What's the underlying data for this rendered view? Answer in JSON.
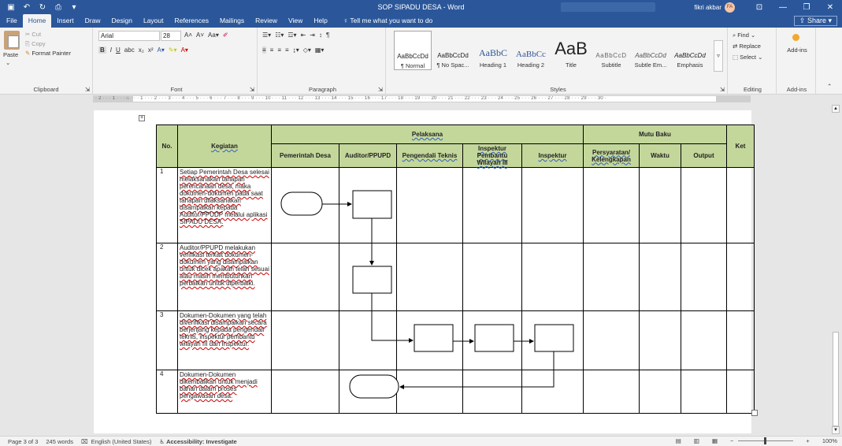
{
  "window": {
    "title": "SOP SIPADU DESA  -  Word",
    "user": "fikri akbar",
    "avatar": "FA"
  },
  "qat": {
    "save_icon": "save-icon",
    "undo_icon": "undo-icon",
    "redo_icon": "redo-icon",
    "preview_icon": "print-preview-icon"
  },
  "tabs": [
    "File",
    "Home",
    "Insert",
    "Draw",
    "Design",
    "Layout",
    "References",
    "Mailings",
    "Review",
    "View",
    "Help"
  ],
  "tell_me": "Tell me what you want to do",
  "share": "Share",
  "ribbon": {
    "clipboard": {
      "label": "Clipboard",
      "paste": "Paste",
      "cut": "Cut",
      "copy": "Copy",
      "format_painter": "Format Painter"
    },
    "font": {
      "label": "Font",
      "name": "Arial",
      "size": "28"
    },
    "paragraph": {
      "label": "Paragraph"
    },
    "styles": {
      "label": "Styles",
      "items": [
        {
          "sample": "AaBbCcDd",
          "name": "¶ Normal"
        },
        {
          "sample": "AaBbCcDd",
          "name": "¶ No Spac..."
        },
        {
          "sample": "AaBbC",
          "name": "Heading 1"
        },
        {
          "sample": "AaBbCc",
          "name": "Heading 2"
        },
        {
          "sample": "AaB",
          "name": "Title"
        },
        {
          "sample": "AaBbCcD",
          "name": "Subtitle"
        },
        {
          "sample": "AaBbCcDd",
          "name": "Subtle Em..."
        },
        {
          "sample": "AaBbCcDd",
          "name": "Emphasis"
        }
      ]
    },
    "editing": {
      "label": "Editing",
      "find": "Find",
      "replace": "Replace",
      "select": "Select"
    },
    "addins": {
      "label": "Add-ins",
      "button": "Add-ins"
    }
  },
  "ruler": "· 2 · · · 1 · · · ⌂ · · · 1 · · · 2 · · · 3 · · · 4 · · · 5 · · · 6 · · · 7 · · · 8 · · · 9 · · · 10 · · · 11 · · · 12 · · · 13 · · · 14 · · · 15 · · · 16 · · · 17 · · · 18 · · · 19 · · · 20 · · · 21 · · · 22 · · · 23 · · · 24 · · · 25 · · · 26 · · · 27 · · · 28 · · · 29 · · · 30 ·",
  "table": {
    "headers": {
      "no": "No.",
      "kegiatan": "Kegiatan",
      "pelaksana": "Pelaksana",
      "mutu_baku": "Mutu Baku",
      "ket": "Ket",
      "pemerintah_desa": "Pemerintah Desa",
      "auditor": "Auditor/PPUPD",
      "pengendali": "Pengendali Teknis",
      "inspektur_pembantu": "Inspektur Pembantu Wilayah III",
      "inspektur": "Inspektur",
      "persyaratan": "Persyaratan/ Kelengkapan",
      "waktu": "Waktu",
      "output": "Output"
    },
    "rows": [
      {
        "no": "1",
        "kegiatan": "Setiap Pemerintah Desa selesai melaksanakan tahapan perencanaan desa, maka dokumen-dokumen pada saat tahapan dilaksanakan disampaikan kepada Auditor/PPUDP melalui aplikasi SIPADU DESA."
      },
      {
        "no": "2",
        "kegiatan": "Auditor/PPUPD melakukan verifikasi terkait dokumen-dokumen yang disampaikan untuk dicek apakah telah sesuai atau masih membutuhkan perbaikan untuk diperbaiki."
      },
      {
        "no": "3",
        "kegiatan": "Dokumen-Dokumen yang telah diverifikasi disampaikan secara berjenjang kepada pengendali teknis, inspektur pembantu wilayah III dan Inspektur."
      },
      {
        "no": "4",
        "kegiatan": "Dokumen-Dokumen dikembalikan untuk menjadi bahan dalam proses pengawasan desa."
      }
    ]
  },
  "status": {
    "page": "Page 3 of 3",
    "words": "245 words",
    "language": "English (United States)",
    "accessibility": "Accessibility: Investigate",
    "zoom": "100%"
  }
}
